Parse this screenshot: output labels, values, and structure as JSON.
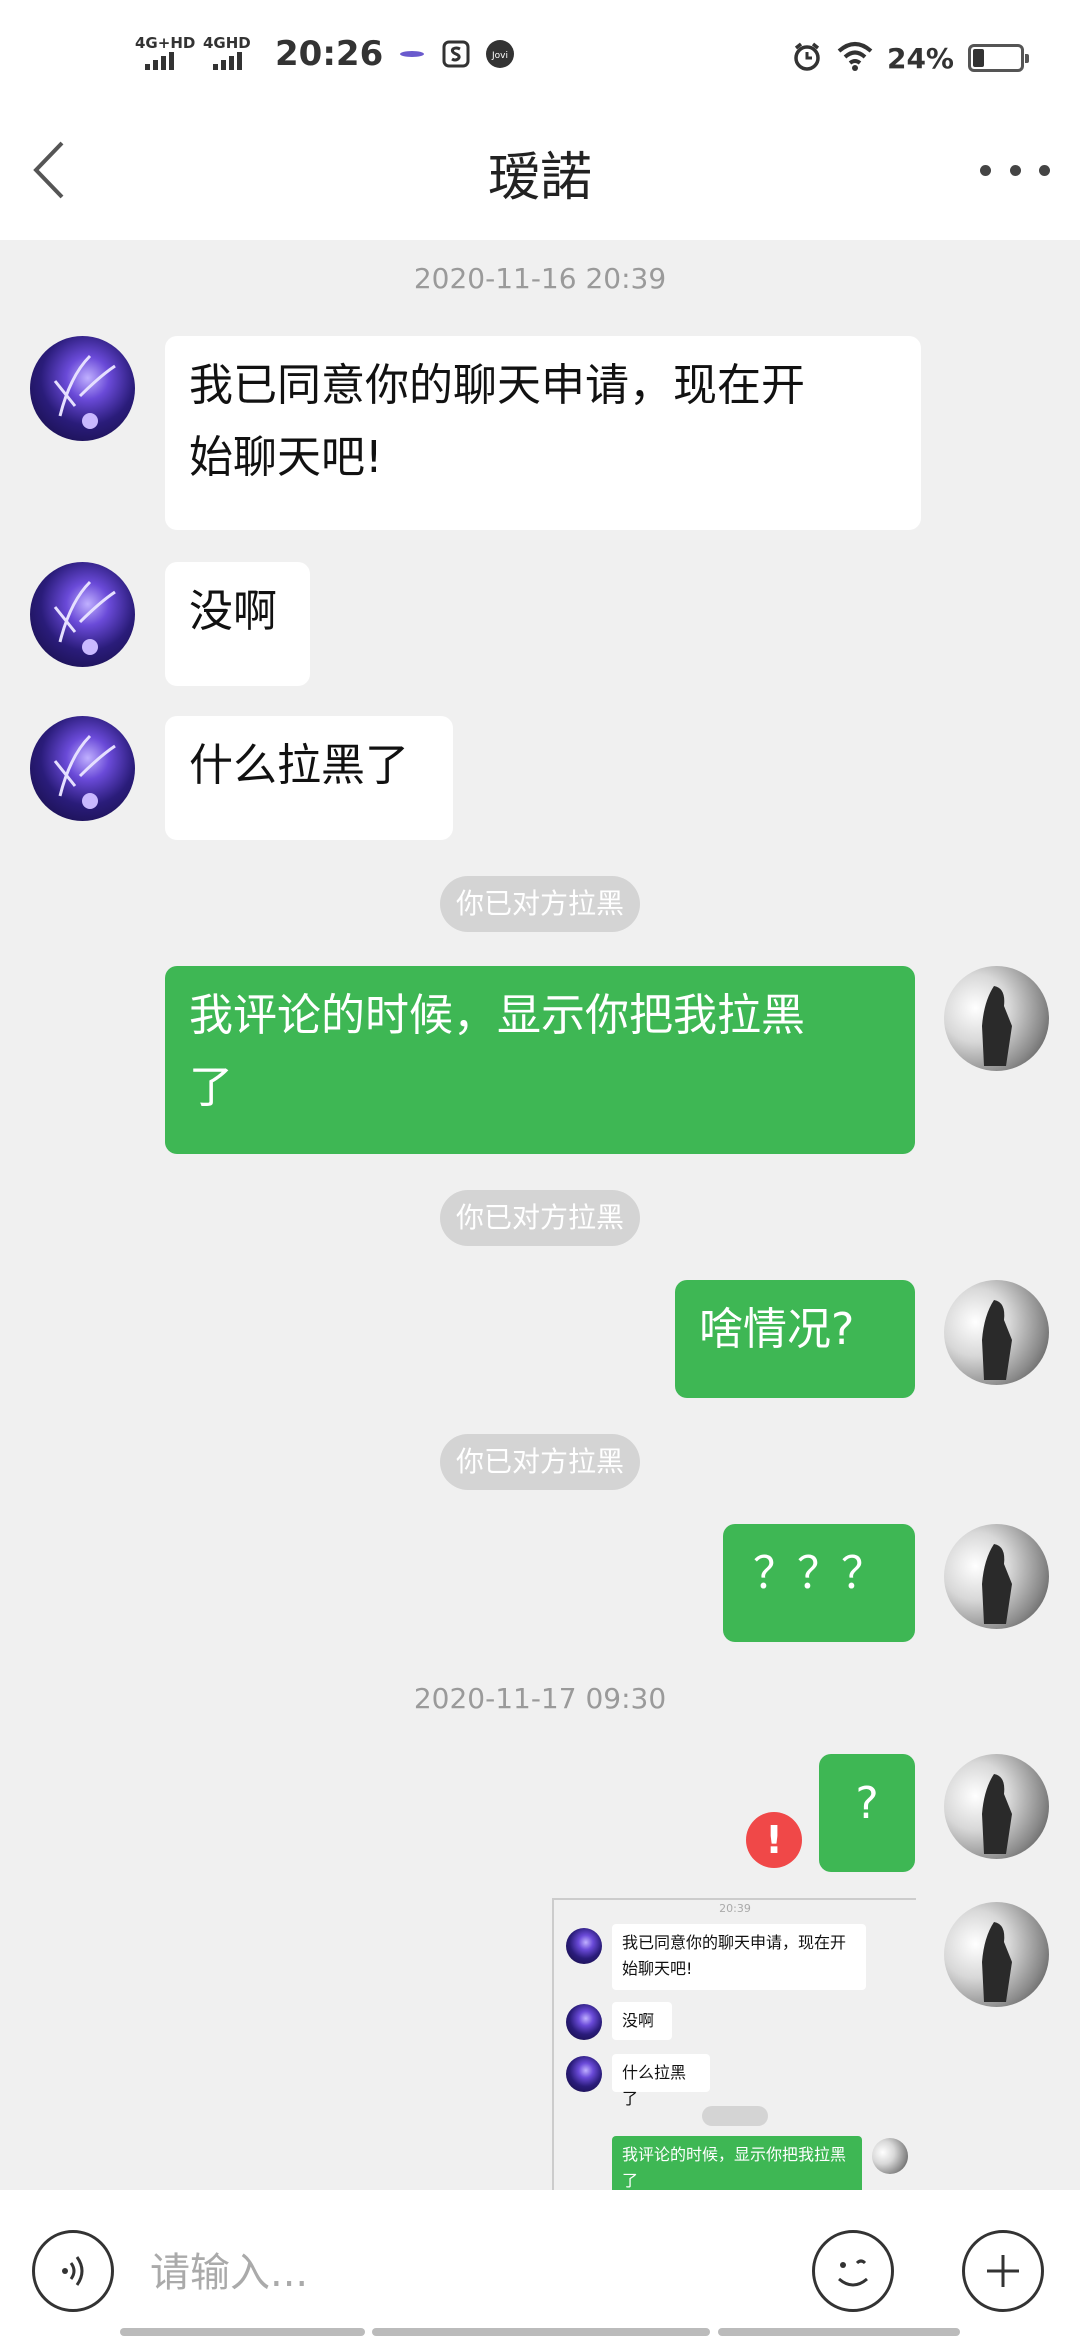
{
  "status_bar": {
    "signal1": "4G+HD",
    "signal2": "4GHD",
    "time": "20:26",
    "battery": "24%",
    "battery_level": 0.24
  },
  "header": {
    "title": "瑷諾"
  },
  "messages": {
    "ts1": "2020-11-16 20:39",
    "m1_line1": "我已同意你的聊天申请，现在开",
    "m1_line2": "始聊天吧!",
    "m2": "没啊",
    "m3": "什么拉黑了",
    "sys": "你已对方拉黑",
    "m4_line1": "我评论的时候，显示你把我拉黑",
    "m4_line2": "了",
    "m5": "啥情况?",
    "m6": "？？？",
    "ts2": "2020-11-17 09:30",
    "m7": "?",
    "error_mark": "!"
  },
  "image_message": {
    "time": "20:39",
    "m1_line1": "我已同意你的聊天申请，现在开",
    "m1_line2": "始聊天吧!",
    "m2": "没啊",
    "m3": "什么拉黑了",
    "m4_line1": "我评论的时候，显示你把我拉黑",
    "m4_line2": "了"
  },
  "input_bar": {
    "placeholder": "请输入..."
  }
}
